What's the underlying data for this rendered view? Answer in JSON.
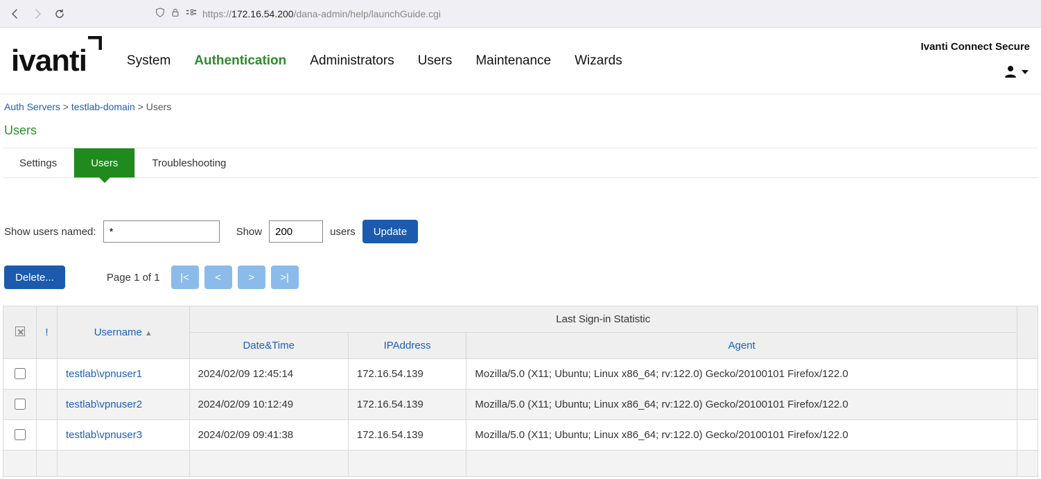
{
  "browser": {
    "url_proto": "https://",
    "url_host": "172.16.54.200",
    "url_rest": "/dana-admin/help/launchGuide.cgi"
  },
  "brand": "Ivanti Connect Secure",
  "logo_text": "ivanti",
  "top_nav": {
    "items": [
      "System",
      "Authentication",
      "Administrators",
      "Users",
      "Maintenance",
      "Wizards"
    ],
    "active_index": 1
  },
  "breadcrumb": {
    "items": [
      {
        "label": "Auth Servers",
        "link": true
      },
      {
        "label": "testlab-domain",
        "link": true
      },
      {
        "label": "Users",
        "link": false
      }
    ]
  },
  "page_title": "Users",
  "tabs": {
    "items": [
      "Settings",
      "Users",
      "Troubleshooting"
    ],
    "active_index": 1
  },
  "filter": {
    "named_label": "Show users named:",
    "named_value": "*",
    "show_label": "Show",
    "show_value": "200",
    "users_label": "users",
    "update_label": "Update"
  },
  "actions": {
    "delete_label": "Delete...",
    "page_label": "Page 1 of 1",
    "first": "|<",
    "prev": "<",
    "next": ">",
    "last": ">|"
  },
  "table": {
    "headers": {
      "bang": "!",
      "username": "Username",
      "stat_group": "Last Sign-in Statistic",
      "datetime": "Date&Time",
      "ip": "IPAddress",
      "agent": "Agent"
    },
    "rows": [
      {
        "username": "testlab\\vpnuser1",
        "datetime": "2024/02/09 12:45:14",
        "ip": "172.16.54.139",
        "agent": "Mozilla/5.0 (X11; Ubuntu; Linux x86_64; rv:122.0) Gecko/20100101 Firefox/122.0"
      },
      {
        "username": "testlab\\vpnuser2",
        "datetime": "2024/02/09 10:12:49",
        "ip": "172.16.54.139",
        "agent": "Mozilla/5.0 (X11; Ubuntu; Linux x86_64; rv:122.0) Gecko/20100101 Firefox/122.0"
      },
      {
        "username": "testlab\\vpnuser3",
        "datetime": "2024/02/09 09:41:38",
        "ip": "172.16.54.139",
        "agent": "Mozilla/5.0 (X11; Ubuntu; Linux x86_64; rv:122.0) Gecko/20100101 Firefox/122.0"
      }
    ]
  }
}
